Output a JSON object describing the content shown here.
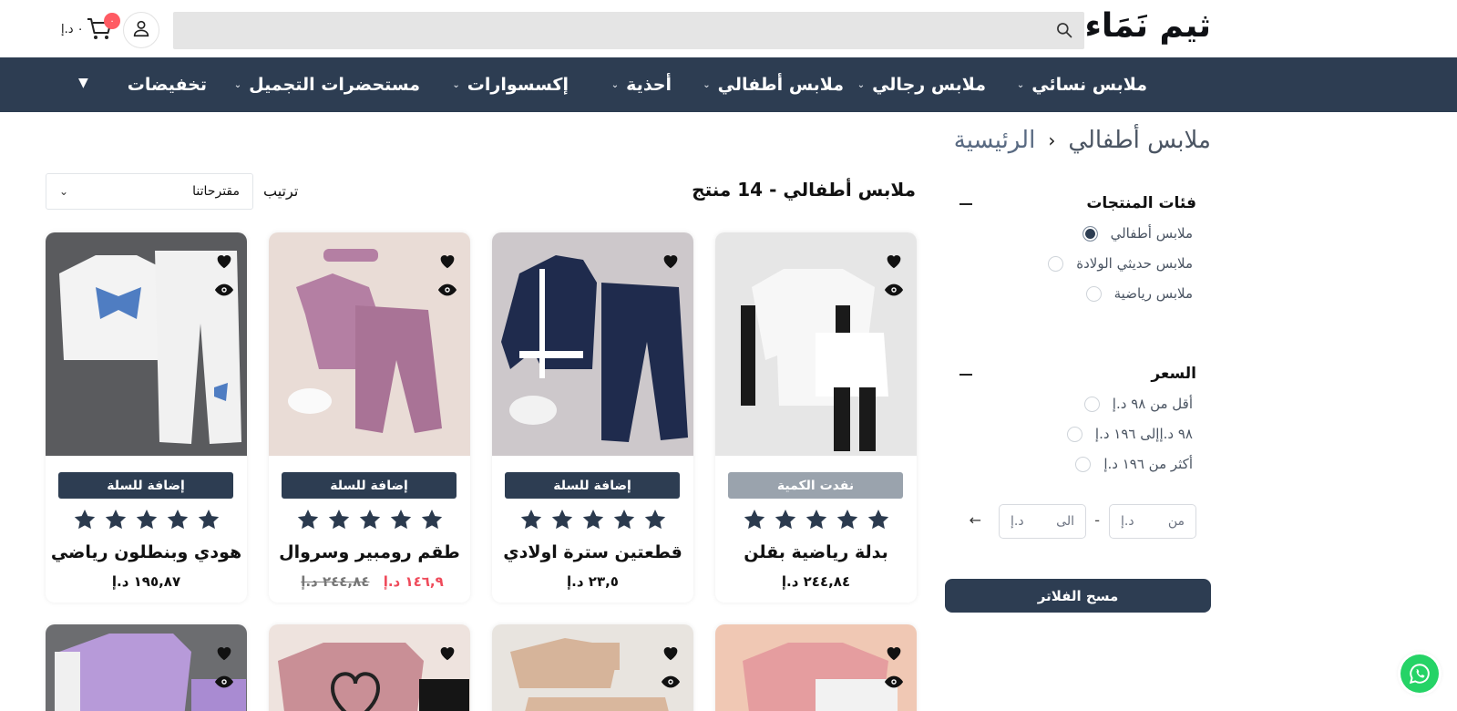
{
  "header": {
    "logo": "ثيم نَمَاء",
    "search_placeholder": "",
    "cart_count": "٠",
    "cart_total": "٠ د.إ"
  },
  "nav": {
    "items": [
      {
        "label": "ملابس نسائي",
        "has_dropdown": true
      },
      {
        "label": "ملابس رجالي",
        "has_dropdown": true
      },
      {
        "label": "ملابس أطفالي",
        "has_dropdown": true
      },
      {
        "label": "أحذية",
        "has_dropdown": true
      },
      {
        "label": "إكسسوارات",
        "has_dropdown": true
      },
      {
        "label": "مستحضرات التجميل",
        "has_dropdown": true
      },
      {
        "label": "تخفيضات",
        "has_dropdown": false
      }
    ]
  },
  "breadcrumb": {
    "home": "الرئيسية",
    "current": "ملابس أطفالي"
  },
  "filters": {
    "categories": {
      "title": "فئات المنتجات",
      "options": [
        {
          "label": "ملابس أطفالي",
          "checked": true
        },
        {
          "label": "ملابس حديثي الولادة",
          "checked": false
        },
        {
          "label": "ملابس رياضية",
          "checked": false
        }
      ]
    },
    "price": {
      "title": "السعر",
      "options": [
        {
          "label": "أقل من ٩٨ د.إ",
          "checked": false
        },
        {
          "label": "٩٨ د.إإلى ١٩٦ د.إ",
          "checked": false
        },
        {
          "label": "أكثر من ١٩٦ د.إ",
          "checked": false
        }
      ],
      "from_label": "من",
      "to_label": "الى",
      "currency": "د.إ"
    },
    "clear_label": "مسح الفلاتر"
  },
  "results": {
    "title": "ملابس أطفالي - 14 منتج",
    "sort_label": "ترتيب",
    "sort_value": "مقترحاتنا"
  },
  "products": [
    {
      "name": "بدلة رياضية بقلن",
      "price": "٢٤٤,٨٤ د.إ",
      "sale_price": "",
      "old_price": "",
      "cta": "نفدت الكمية",
      "sold_out": true,
      "rating": 5
    },
    {
      "name": "قطعتين سترة اولادي",
      "price": "٢٣,٥ د.إ",
      "sale_price": "",
      "old_price": "",
      "cta": "إضافة للسلة",
      "sold_out": false,
      "rating": 5
    },
    {
      "name": "طقم رومبير وسروال",
      "price": "",
      "sale_price": "١٤٦,٩ د.إ",
      "old_price": "٢٤٤,٨٤ د.إ",
      "cta": "إضافة للسلة",
      "sold_out": false,
      "rating": 5
    },
    {
      "name": "هودي وبنطلون رياضي",
      "price": "١٩٥,٨٧ د.إ",
      "sale_price": "",
      "old_price": "",
      "cta": "إضافة للسلة",
      "sold_out": false,
      "rating": 5
    }
  ],
  "colors": {
    "navy": "#2d3d52",
    "accent_red": "#ef4b5b",
    "whatsapp": "#25d366"
  },
  "icons": [
    "search-icon",
    "user-icon",
    "cart-icon",
    "heart-icon",
    "eye-icon",
    "star-icon",
    "chevron-down-icon",
    "arrow-left-icon",
    "minus-icon",
    "whatsapp-icon"
  ]
}
